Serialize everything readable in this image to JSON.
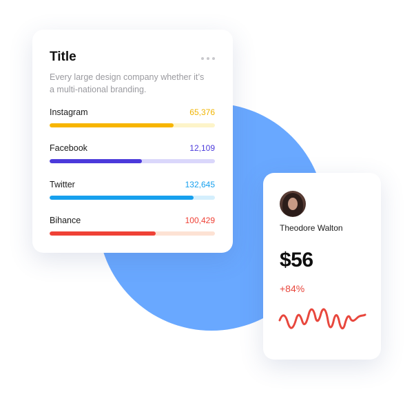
{
  "colors": {
    "blob": "#69a8ff",
    "accent_red": "#e8473d"
  },
  "stats_card": {
    "title": "Title",
    "more_icon": "more-horizontal-icon",
    "description": "Every large design company whether it’s a multi-national branding.",
    "items": [
      {
        "label": "Instagram",
        "value": "65,376",
        "fill": 0.75,
        "color": "#f7b500",
        "track": "#fdf4c9",
        "value_color": "#f0b400"
      },
      {
        "label": "Facebook",
        "value": "12,109",
        "fill": 0.56,
        "color": "#4b3adb",
        "track": "#dad7fb",
        "value_color": "#4b3adb"
      },
      {
        "label": "Twitter",
        "value": "132,645",
        "fill": 0.87,
        "color": "#16a0ee",
        "track": "#d4effd",
        "value_color": "#16a0ee"
      },
      {
        "label": "Bihance",
        "value": "100,429",
        "fill": 0.64,
        "color": "#ef4136",
        "track": "#fde2d4",
        "value_color": "#ef4136"
      }
    ]
  },
  "profile_card": {
    "avatar": "user-avatar",
    "name": "Theodore Walton",
    "amount": "$56",
    "change": "+84%",
    "sparkline_icon": "trend-sparkline-icon"
  }
}
